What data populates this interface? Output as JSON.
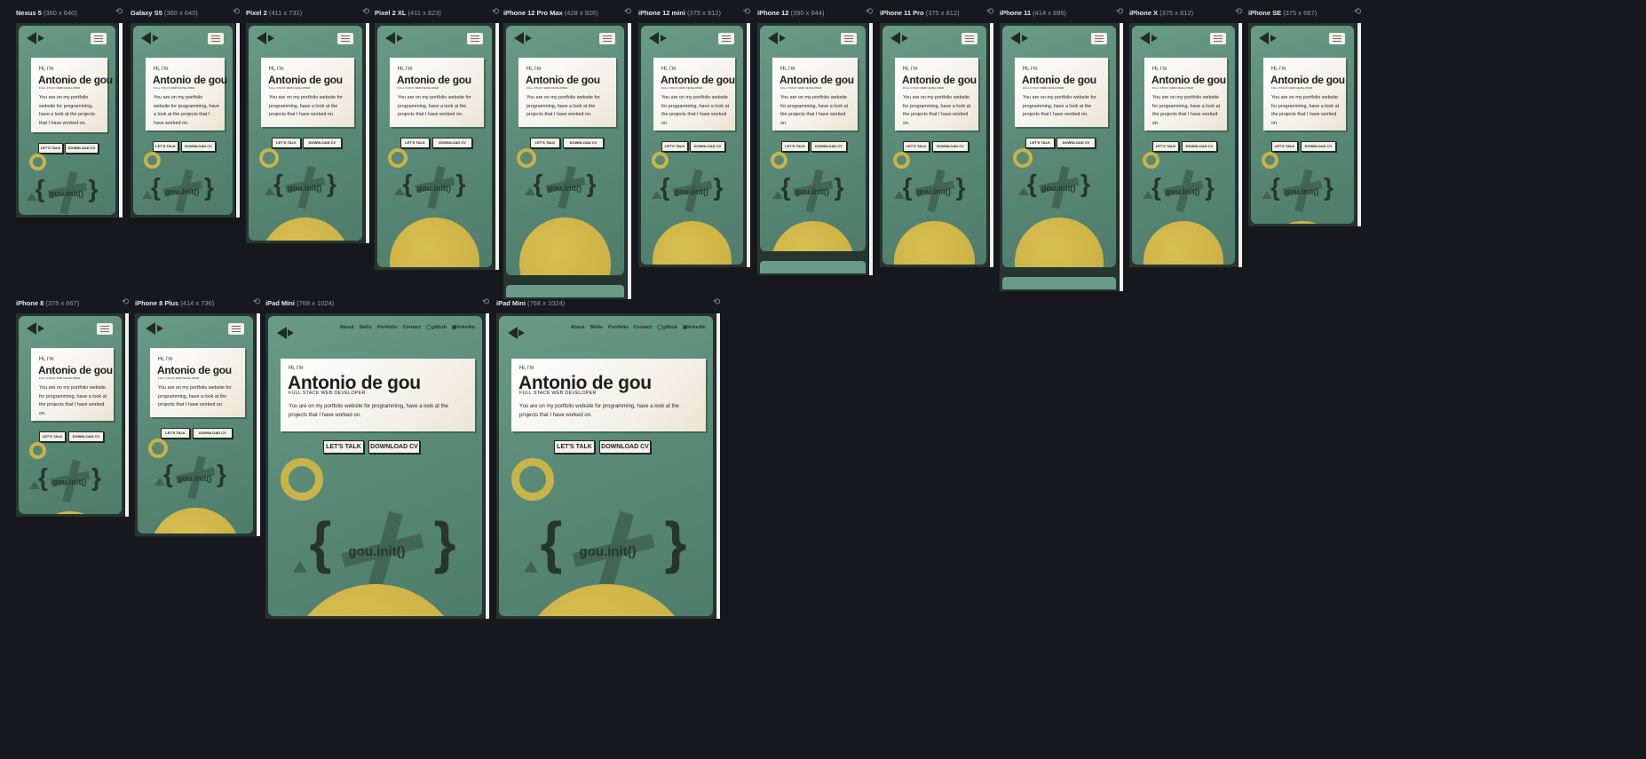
{
  "devices": [
    {
      "name": "Nexus 5",
      "size": "(360 x 640)"
    },
    {
      "name": "Galaxy S5",
      "size": "(360 x 640)"
    },
    {
      "name": "Pixel 2",
      "size": "(411 x 731)"
    },
    {
      "name": "Pixel 2 XL",
      "size": "(411 x 823)"
    },
    {
      "name": "iPhone 12 Pro Max",
      "size": "(428 x 926)"
    },
    {
      "name": "iPhone 12 mini",
      "size": "(375 x 812)"
    },
    {
      "name": "iPhone 12",
      "size": "(390 x 844)"
    },
    {
      "name": "iPhone 11 Pro",
      "size": "(375 x 812)"
    },
    {
      "name": "iPhone 11",
      "size": "(414 x 896)"
    },
    {
      "name": "iPhone X",
      "size": "(375 x 812)"
    },
    {
      "name": "iPhone SE",
      "size": "(375 x 667)"
    },
    {
      "name": "iPhone 8",
      "size": "(375 x 667)"
    },
    {
      "name": "iPhone 8 Plus",
      "size": "(414 x 736)"
    },
    {
      "name": "iPad Mini",
      "size": "(768 x 1024)"
    },
    {
      "name": "iPad Mini",
      "size": "(768 x 1024)"
    }
  ],
  "site": {
    "greeting": "Hi, i'm",
    "name": "Antonio de gou",
    "role": "FULL STACK WEB DEVELOPER",
    "description": "You are on my portfolio website for programming, have a look at the projects that I have worked on.",
    "talk_button": "LET'S TALK",
    "cv_button": "DOWNLOAD CV",
    "logo_text": "gou.init()",
    "brace_open": "{",
    "brace_close": "}",
    "nav": {
      "about": "About",
      "skills": "Skills",
      "portfolio": "Portfolio",
      "contact": "Contact",
      "github": "github",
      "linkedin": "linkedin"
    }
  },
  "icons": {
    "rotate": "rotate-icon",
    "back": "back-arrow-icon",
    "forward": "forward-arrow-icon",
    "menu": "hamburger-menu-icon",
    "github": "github-icon",
    "linkedin": "linkedin-icon",
    "ring": "ring-icon",
    "cross": "cross-icon",
    "triangle": "triangle-icon"
  },
  "colors": {
    "background": "#17181d",
    "screen": "#5b8a78",
    "card": "#f3efe6",
    "accent": "#c9b44a",
    "dark": "#26352e"
  }
}
